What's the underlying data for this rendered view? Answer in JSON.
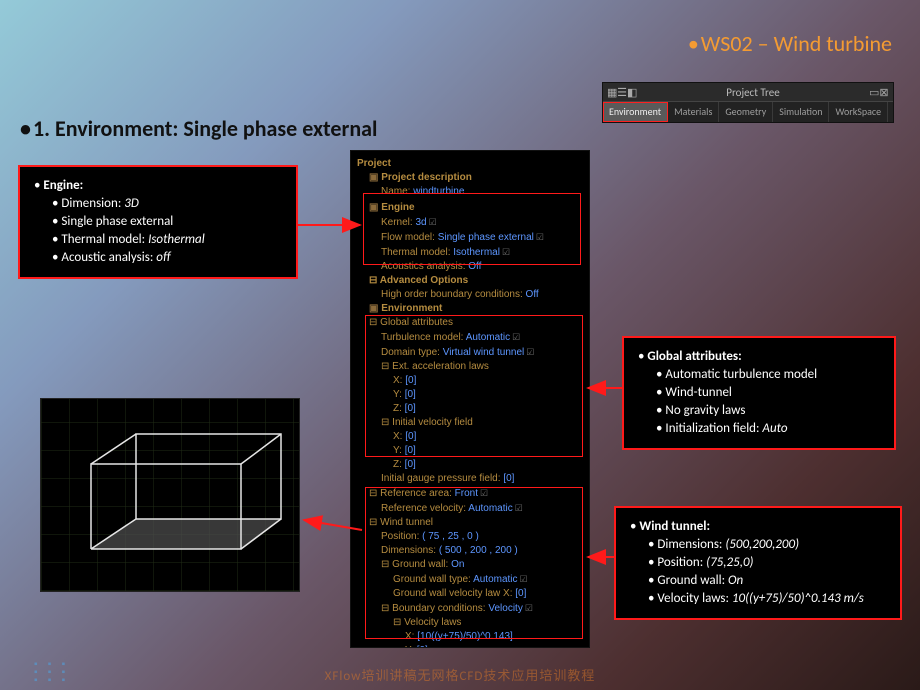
{
  "slide": {
    "title": "WS02 – Wind turbine",
    "heading": "1. Environment: Single phase external",
    "footer": "XFlow培训讲稿无网格CFD技术应用培训教程"
  },
  "project_tree_window": {
    "title": "Project Tree",
    "tabs": [
      "Environment",
      "Materials",
      "Geometry",
      "Simulation",
      "WorkSpace"
    ],
    "active_tab": 0
  },
  "tree": {
    "project": "Project",
    "project_desc": "Project description",
    "name_label": "Name:",
    "name_value": "windturbine",
    "engine": "Engine",
    "kernel_label": "Kernel:",
    "kernel_value": "3d",
    "flowmodel_label": "Flow model:",
    "flowmodel_value": "Single phase external",
    "thermal_label": "Thermal model:",
    "thermal_value": "Isothermal",
    "acoustics_label": "Acoustics analysis:",
    "acoustics_value": "Off",
    "advopts": "Advanced Options",
    "highorder_label": "High order boundary conditions:",
    "highorder_value": "Off",
    "environment": "Environment",
    "globalattr": "Global attributes",
    "turb_label": "Turbulence model:",
    "turb_value": "Automatic",
    "domain_label": "Domain type:",
    "domain_value": "Virtual wind tunnel",
    "extaccel": "Ext. acceleration laws",
    "x_label": "X:",
    "y_label": "Y:",
    "z_label": "Z:",
    "zero": "[0]",
    "ivf": "Initial velocity field",
    "igp_label": "Initial gauge pressure field:",
    "igp_value": "[0]",
    "refarea_label": "Reference area:",
    "refarea_value": "Front",
    "refvel_label": "Reference velocity:",
    "refvel_value": "Automatic",
    "windtunnel": "Wind tunnel",
    "pos_label": "Position:",
    "pos_value": "( 75 , 25 , 0 )",
    "dim_label": "Dimensions:",
    "dim_value": "( 500 , 200 , 200 )",
    "gw_label": "Ground wall:",
    "gw_value": "On",
    "gwtype_label": "Ground wall type:",
    "gwtype_value": "Automatic",
    "gwvel_label": "Ground wall velocity law X:",
    "gwvel_value": "[0]",
    "bc_label": "Boundary conditions:",
    "bc_value": "Velocity",
    "vlaws": "Velocity laws",
    "vlaw_x": "[10((y+75)/50)^0.143]"
  },
  "callouts": {
    "engine": {
      "title": "Engine:",
      "l1_label": "Dimension: ",
      "l1_val": "3D",
      "l2": "Single phase external",
      "l3_label": "Thermal model: ",
      "l3_val": "Isothermal",
      "l4_label": "Acoustic analysis: ",
      "l4_val": "off"
    },
    "global": {
      "title": "Global attributes:",
      "l1": "Automatic turbulence model",
      "l2": "Wind-tunnel",
      "l3": "No gravity laws",
      "l4_label": "Initialization field: ",
      "l4_val": "Auto"
    },
    "wind": {
      "title": "Wind tunnel:",
      "l1_label": "Dimensions: ",
      "l1_val": "(500,200,200)",
      "l2_label": "Position: ",
      "l2_val": "(75,25,0)",
      "l3_label": "Ground wall: ",
      "l3_val": "On",
      "l4_label": "Velocity laws: ",
      "l4_val": "10((y+75)/50)^0.143  m/s"
    }
  }
}
